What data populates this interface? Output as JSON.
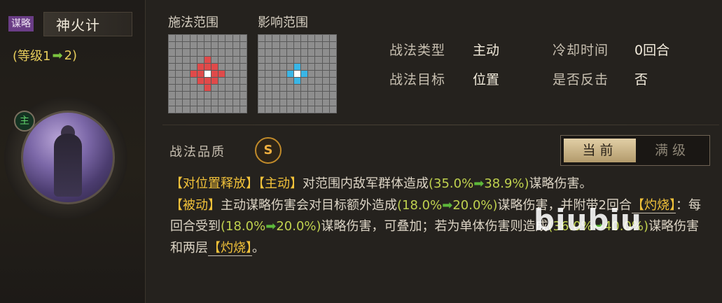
{
  "skill": {
    "type_tag": "谋略",
    "name": "神火计",
    "level_open": "(等级1",
    "level_arrow": "➡",
    "level_close": "2)",
    "main_badge": "主"
  },
  "grids": {
    "cast_label": "施法范围",
    "effect_label": "影响范围"
  },
  "attributes": {
    "type_label": "战法类型",
    "type_value": "主动",
    "cooldown_label": "冷却时间",
    "cooldown_value": "0回合",
    "target_label": "战法目标",
    "target_value": "位置",
    "counter_label": "是否反击",
    "counter_value": "否"
  },
  "quality": {
    "label": "战法品质",
    "grade": "S"
  },
  "toggle": {
    "current": "当前",
    "max": "满级"
  },
  "description": {
    "p1_tag1": "【对位置释放】",
    "p1_tag2": "【主动】",
    "p1_text1": "对范围内敌军群体造成",
    "p1_open": "(",
    "p1_from": "35.0%",
    "arrow": "➡",
    "p1_to": "38.9%",
    "p1_close": ")",
    "p1_text2": "谋略伤害。",
    "p2_tag": "【被动】",
    "p2_text1": "主动谋略伤害会对目标额外造成",
    "p2_open": "(",
    "p2_from": "18.0%",
    "p2_to": "20.0%",
    "p2_close": ")",
    "p2_text2": "谋略伤害，并附带2回合",
    "burn": "【灼烧】",
    "p2_text3": "：每回合受到",
    "p2_from2": "18.0%",
    "p2_to2": "20.0%",
    "p2_text4": "谋略伤害，可叠加；若为单体伤害则造成",
    "p2_from3": "36.0%",
    "p2_to3": "40.0%",
    "p2_text5": "谋略伤害和两层",
    "p2_end": "。"
  },
  "watermark": "biubiu"
}
